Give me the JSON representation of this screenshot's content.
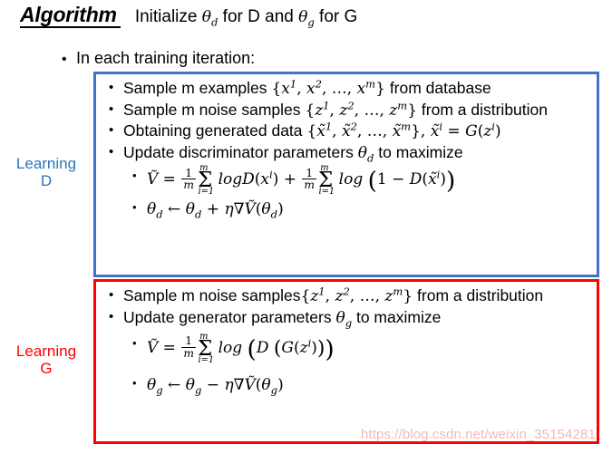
{
  "header": {
    "title": "Algorithm",
    "init_text_prefix": "Initialize ",
    "init_theta_d": "θ",
    "init_theta_d_sub": "d",
    "init_mid": " for D and ",
    "init_theta_g": "θ",
    "init_theta_g_sub": "g",
    "init_suffix": " for G",
    "init_full": "Initialize θd for D and θg for G"
  },
  "iteration_line": "In each training iteration:",
  "side_labels": {
    "learning_d_line1": "Learning",
    "learning_d_line2": "D",
    "learning_d_color": "#2e74b5",
    "learning_g_line1": "Learning",
    "learning_g_line2": "G",
    "learning_g_color": "#ff0000"
  },
  "blue_box": {
    "border_color": "#4472c4",
    "steps": [
      {
        "text_before": "Sample m examples ",
        "math": "{x¹, x², …, xᵐ}",
        "text_after": " from database",
        "full": "Sample m examples {x1, x2, ..., xm} from database"
      },
      {
        "text_before": "Sample m noise samples ",
        "math": "{z¹, z², …, zᵐ}",
        "text_after": " from a distribution",
        "full": "Sample m noise samples {z1, z2, ..., zm} from a distribution"
      },
      {
        "text_before": "Obtaining generated data ",
        "math": "{x̃¹, x̃², …, x̃ᵐ}, x̃ⁱ = G(zⁱ)",
        "text_after": "",
        "full": "Obtaining generated data {x̃1, x̃2, ..., x̃m}, x̃i = G(zi)"
      },
      {
        "text_before": "Update discriminator parameters ",
        "math": "θd",
        "text_after": " to maximize",
        "full": "Update discriminator parameters θd to maximize"
      }
    ],
    "formulas": [
      {
        "id": "v-tilde-discriminator",
        "latex": "\\tilde{V} = \\frac{1}{m}\\sum_{i=1}^{m} logD(x^i) + \\frac{1}{m}\\sum_{i=1}^{m} log\\left(1 - D(\\tilde{x}^i)\\right)",
        "plain": "Ṽ = (1/m) Σ i=1..m logD(x^i) + (1/m) Σ i=1..m log(1 − D(x̃^i))"
      },
      {
        "id": "theta-d-update",
        "latex": "\\theta_d \\leftarrow \\theta_d + \\eta\\nabla\\tilde{V}(\\theta_d)",
        "plain": "θd ← θd + η∇Ṽ(θd)"
      }
    ]
  },
  "red_box": {
    "border_color": "#ff0000",
    "steps": [
      {
        "text_before": "Sample m noise samples",
        "math": "{z¹, z², …, zᵐ}",
        "text_after": " from a distribution",
        "full": "Sample m noise samples{z1, z2, ..., zm} from a distribution"
      },
      {
        "text_before": "Update generator parameters ",
        "math": "θg",
        "text_after": " to maximize",
        "full": "Update generator parameters θg to maximize"
      }
    ],
    "formulas": [
      {
        "id": "v-tilde-generator",
        "latex": "\\tilde{V} = \\frac{1}{m}\\sum_{i=1}^{m} log\\left(D\\left(G(z^i)\\right)\\right)",
        "plain": "Ṽ = (1/m) Σ i=1..m log(D(G(z^i)))"
      },
      {
        "id": "theta-g-update",
        "latex": "\\theta_g \\leftarrow \\theta_g - \\eta\\nabla\\tilde{V}(\\theta_g)",
        "plain": "θg ← θg − η∇Ṽ(θg)"
      }
    ]
  },
  "watermark": {
    "text": "https://blog.csdn.net/weixin_35154281",
    "color": "#f2b6b6"
  },
  "symbols": {
    "bullet": "•",
    "sigma": "Σ",
    "nabla": "∇",
    "eta": "η",
    "theta": "θ",
    "arrow_left": "←",
    "minus": "−",
    "plus": "+",
    "equals": "=",
    "ellipsis": "…"
  }
}
